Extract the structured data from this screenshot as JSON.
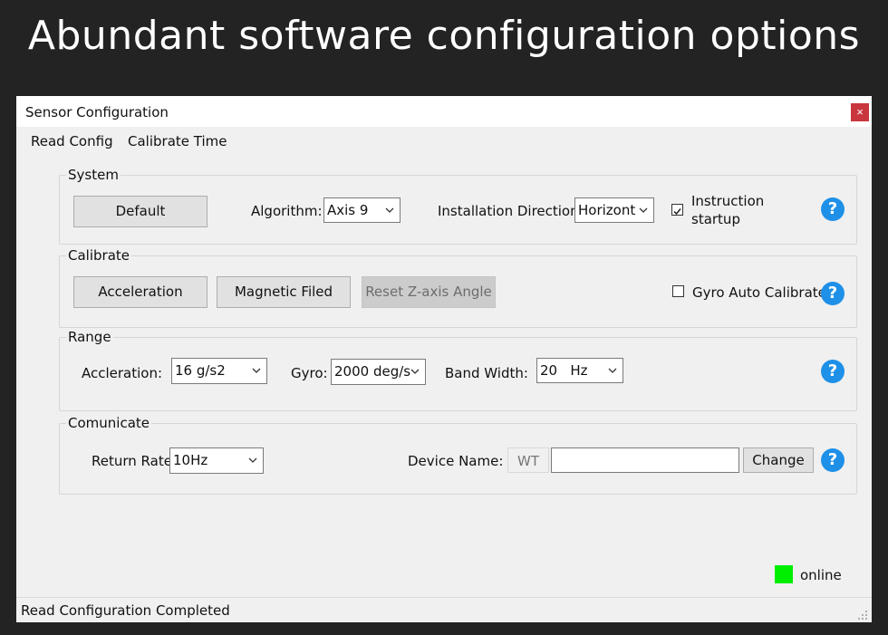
{
  "banner": {
    "headline": "Abundant software configuration options"
  },
  "window": {
    "title": "Sensor Configuration",
    "close_glyph": "×"
  },
  "menu": {
    "items": [
      "Read Config",
      "Calibrate Time"
    ]
  },
  "system": {
    "label": "System",
    "default_button": "Default",
    "algorithm_label": "Algorithm:",
    "algorithm_value": "Axis 9",
    "installation_label": "Installation Direction:",
    "installation_value": "Horizontal",
    "instruction_line1": "Instruction",
    "instruction_line2": "startup",
    "instruction_checked": true
  },
  "calibrate": {
    "label": "Calibrate",
    "acceleration_button": "Acceleration",
    "magnetic_button": "Magnetic Filed",
    "reset_button": "Reset Z-axis Angle",
    "gyro_label": "Gyro Auto Calibrate",
    "gyro_checked": false
  },
  "range": {
    "label": "Range",
    "accel_label": "Accleration:",
    "accel_value": "16 g/s2",
    "gyro_label": "Gyro:",
    "gyro_value": "2000 deg/s",
    "bandwidth_label": "Band Width:",
    "bandwidth_value": "20   Hz"
  },
  "communicate": {
    "label": "Comunicate",
    "return_rate_label": "Return Rate:",
    "return_rate_value": "10Hz",
    "device_name_label": "Device Name:",
    "device_prefix": "WT",
    "device_name_value": "",
    "change_button": "Change"
  },
  "help_glyph": "?",
  "status": {
    "online_label": "online",
    "online_color": "#00ee00",
    "message": "Read Configuration Completed"
  }
}
